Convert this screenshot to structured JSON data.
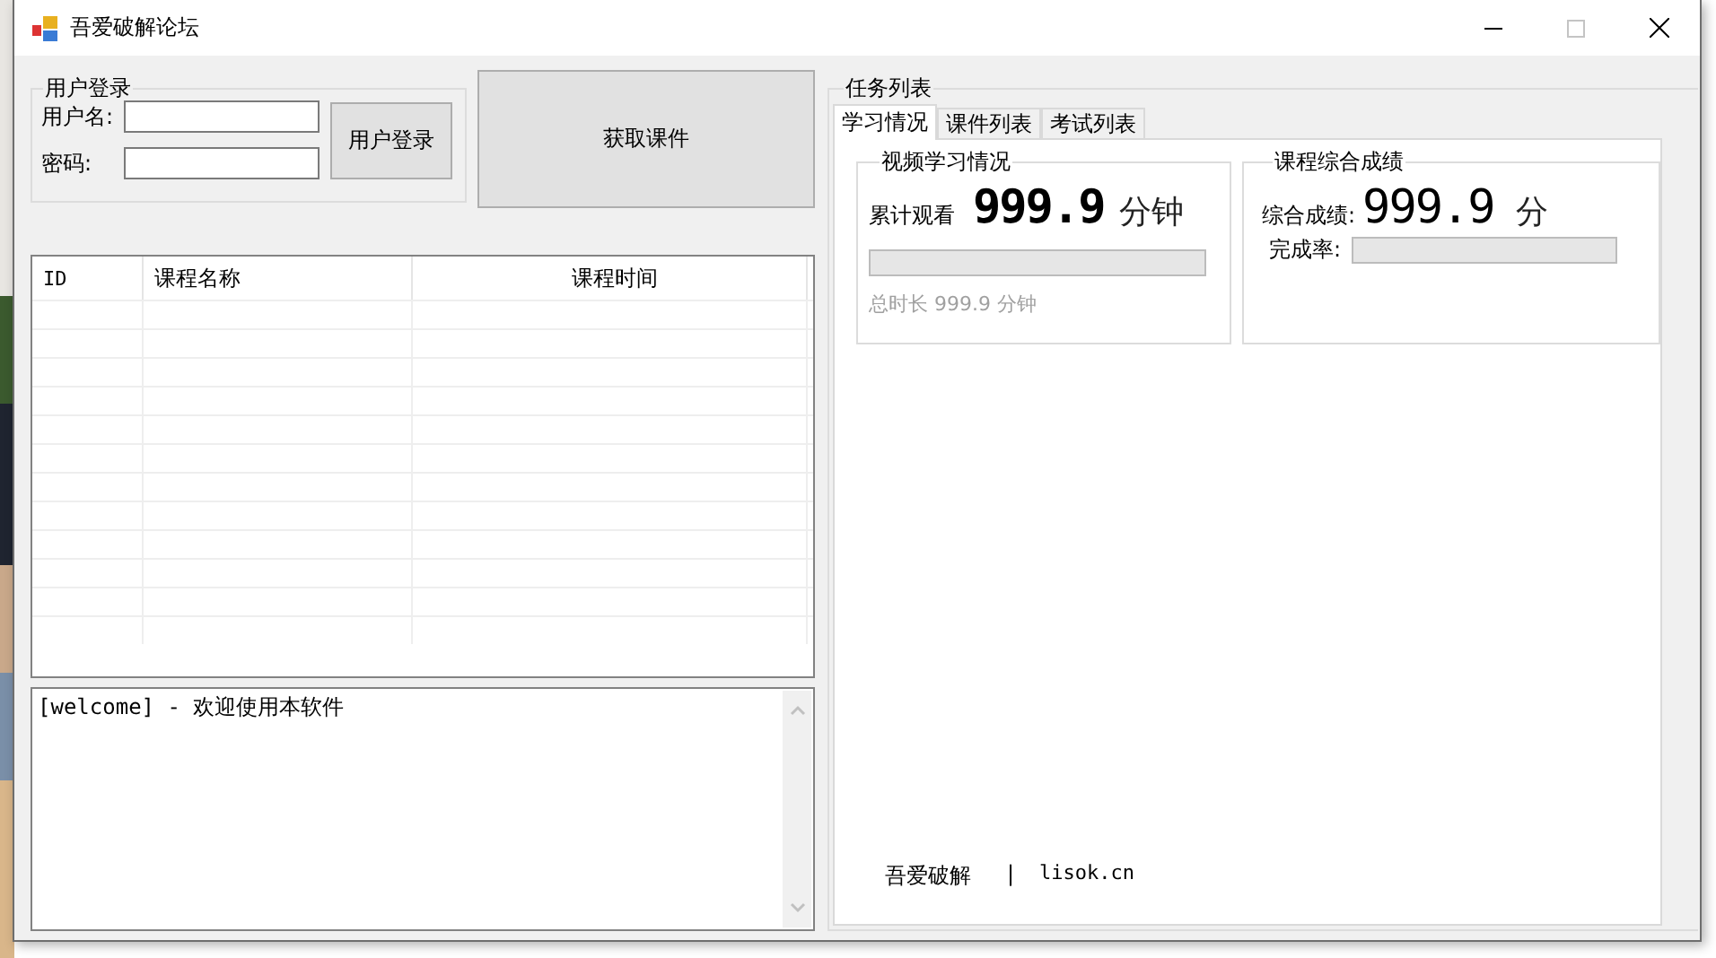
{
  "window": {
    "title": "吾爱破解论坛",
    "controls": [
      {
        "kind": "minimize",
        "disabled": false
      },
      {
        "kind": "maximize",
        "disabled": true
      },
      {
        "kind": "close",
        "disabled": false
      }
    ]
  },
  "login": {
    "title": "用户登录",
    "username_label": "用户名:",
    "password_label": "密码:",
    "button": "用户登录"
  },
  "fetch_button": "获取课件",
  "table": {
    "columns": [
      "ID",
      "课程名称",
      "课程时间"
    ]
  },
  "log": {
    "value": "[welcome] - 欢迎使用本软件"
  },
  "tasks": {
    "title": "任务列表",
    "tabs": [
      {
        "label": "学习情况",
        "selected": true
      },
      {
        "label": "课件列表",
        "selected": false
      },
      {
        "label": "考试列表",
        "selected": false
      }
    ],
    "video": {
      "title": "视频学习情况",
      "watched_label": "累计观看",
      "watched_value": "999.9",
      "watched_unit": "分钟",
      "progress": {
        "level": 0
      },
      "total": "总时长 999.9 分钟"
    },
    "score": {
      "title": "课程综合成绩",
      "score_label": "综合成绩:",
      "score_value": "999.9",
      "score_unit": "分",
      "rate_label": "完成率:",
      "progress": {
        "level": 0
      }
    },
    "footer": {
      "brand": "吾爱破解",
      "separator": "|",
      "site": "lisok.cn"
    }
  }
}
